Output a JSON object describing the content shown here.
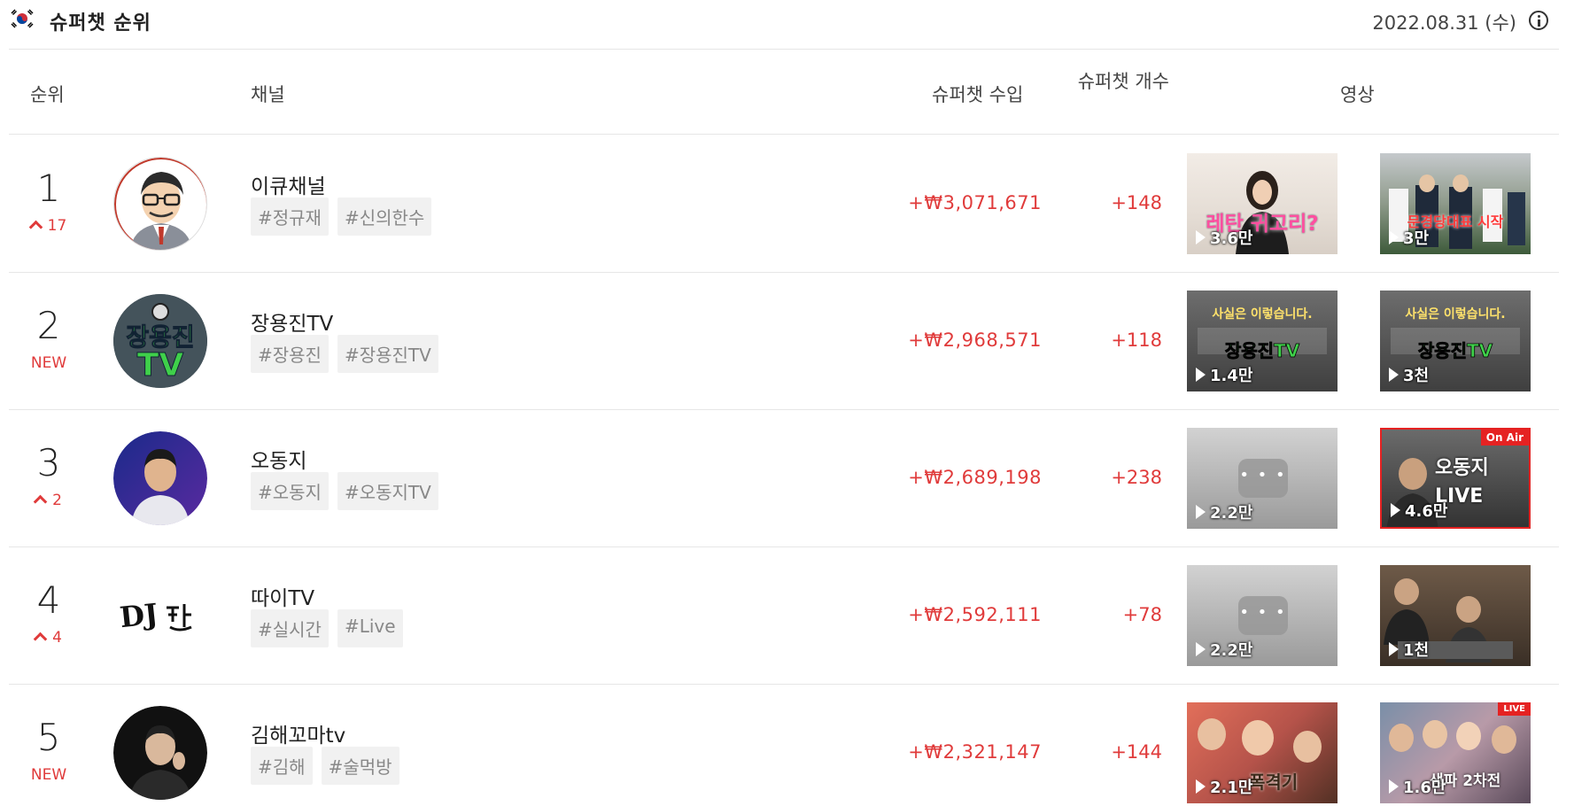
{
  "header": {
    "title": "슈퍼챗 순위",
    "date": "2022.08.31 (수)"
  },
  "columns": {
    "rank": "순위",
    "channel": "채널",
    "income": "슈퍼챗 수입",
    "count": "슈퍼챗 개수",
    "video": "영상"
  },
  "rows": [
    {
      "rank": "1",
      "change": "17",
      "name": "이큐채널",
      "tags": [
        "#정규재",
        "#신의한수"
      ],
      "income": "+₩3,071,671",
      "count": "+148",
      "videos": [
        {
          "views": "3.6만",
          "caption": "레탄 귀고리?"
        },
        {
          "views": "3만",
          "caption": "문경당대표 시작"
        }
      ]
    },
    {
      "rank": "2",
      "change": "NEW",
      "name": "장용진TV",
      "tags": [
        "#장용진",
        "#장용진TV"
      ],
      "income": "+₩2,968,571",
      "count": "+118",
      "videos": [
        {
          "views": "1.4만",
          "caption": "사실은 이렇습니다."
        },
        {
          "views": "3천",
          "caption": "사실은 이렇습니다."
        }
      ]
    },
    {
      "rank": "3",
      "change": "2",
      "name": "오동지",
      "tags": [
        "#오동지",
        "#오동지TV"
      ],
      "income": "+₩2,689,198",
      "count": "+238",
      "videos": [
        {
          "views": "2.2만",
          "caption": ""
        },
        {
          "views": "4.6만",
          "caption": "오동지 LIVE",
          "badge": "On Air"
        }
      ]
    },
    {
      "rank": "4",
      "change": "4",
      "name": "따이TV",
      "tags": [
        "#실시간",
        "#Live"
      ],
      "income": "+₩2,592,111",
      "count": "+78",
      "videos": [
        {
          "views": "2.2만",
          "caption": ""
        },
        {
          "views": "1천",
          "caption": ""
        }
      ]
    },
    {
      "rank": "5",
      "change": "NEW",
      "name": "김해꼬마tv",
      "tags": [
        "#김해",
        "#술먹방"
      ],
      "income": "+₩2,321,147",
      "count": "+144",
      "videos": [
        {
          "views": "2.1만",
          "caption": "폭격기"
        },
        {
          "views": "1.6만",
          "caption": "생파 2차전",
          "badge": "LIVE"
        }
      ]
    }
  ],
  "avatars": [
    "bearded-cartoon-avatar",
    "jangyongjin-tv-logo",
    "ododong-avatar",
    "dj-logo",
    "kimhae-avatar"
  ],
  "colors": {
    "accent": "#e03b3b",
    "tag_bg": "#f1f1f1"
  }
}
